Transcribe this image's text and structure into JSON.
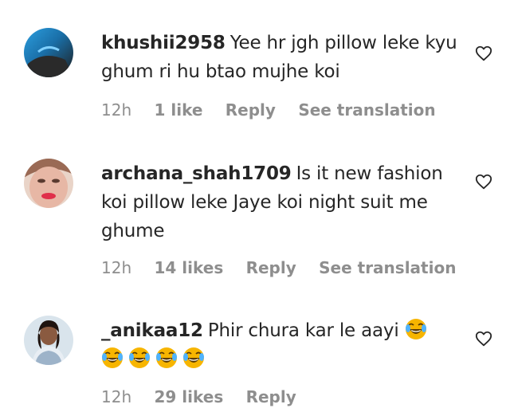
{
  "comments": [
    {
      "username": "khushii2958",
      "text": "Yee hr jgh pillow leke kyu ghum ri hu btao mujhe koi",
      "time": "12h",
      "likes": "1 like",
      "reply": "Reply",
      "translate": "See translation"
    },
    {
      "username": "archana_shah1709",
      "text": "Is it new fashion koi pillow leke Jaye koi night suit me ghume",
      "time": "12h",
      "likes": "14 likes",
      "reply": "Reply",
      "translate": "See translation"
    },
    {
      "username": "_anikaa12",
      "text": "Phir chura kar le aayi",
      "emoji": "face-with-tears-of-joy",
      "emoji_count": 5,
      "time": "12h",
      "likes": "29 likes",
      "reply": "Reply"
    }
  ],
  "colors": {
    "text": "#262626",
    "meta": "#8e8e8e",
    "emoji_face": "#f7b500"
  }
}
